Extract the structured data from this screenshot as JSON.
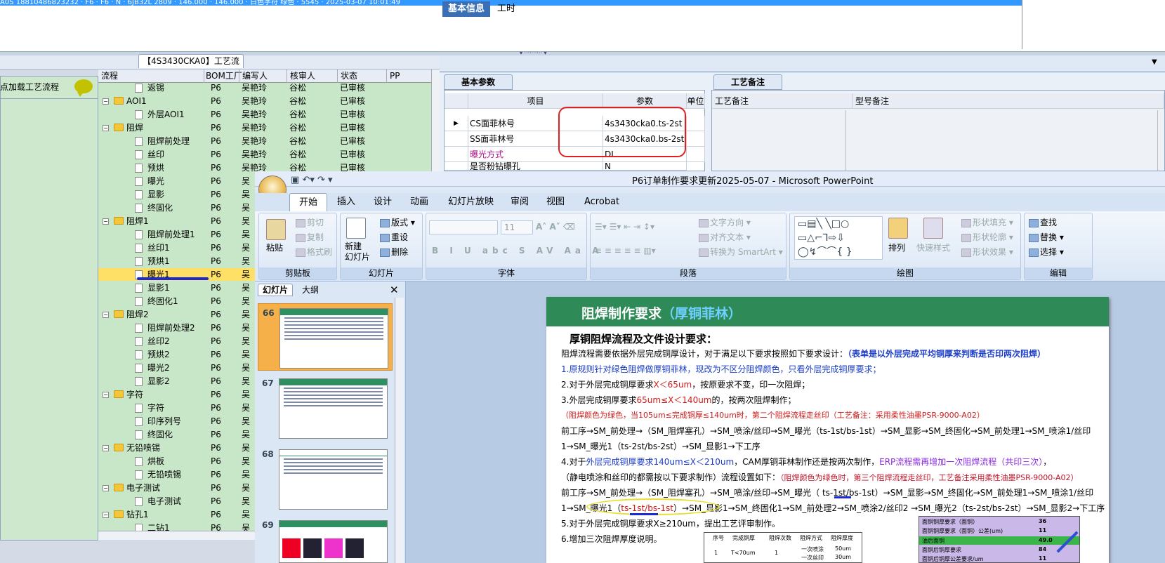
{
  "top_grid": {
    "selected_row_text": "A0S 18810486823232 · F6 · F6 · N · 6JB32L 2809 · 146.000 · 146.000 · 白色字符 绿色 · 5545 · 2025-03-07 10:01:49"
  },
  "process_panel": {
    "tab_title": "【4S3430CKA0】工艺流程",
    "load_label": "点加载工艺流程",
    "columns": [
      "流程",
      "BOM工厂",
      "编写人",
      "核审人",
      "状态",
      "PP"
    ],
    "rows": [
      {
        "level": 2,
        "type": "file",
        "name": "返锡",
        "factory": "P6",
        "writer": "吴艳玲",
        "reviewer": "谷松",
        "status": "已审核"
      },
      {
        "level": 1,
        "type": "folder",
        "name": "AOI1",
        "factory": "P6",
        "writer": "吴艳玲",
        "reviewer": "谷松",
        "status": "已审核"
      },
      {
        "level": 2,
        "type": "file",
        "name": "外层AOI1",
        "factory": "P6",
        "writer": "吴艳玲",
        "reviewer": "谷松",
        "status": "已审核"
      },
      {
        "level": 1,
        "type": "folder",
        "name": "阻焊",
        "factory": "P6",
        "writer": "吴艳玲",
        "reviewer": "谷松",
        "status": "已审核"
      },
      {
        "level": 2,
        "type": "file",
        "name": "阻焊前处理",
        "factory": "P6",
        "writer": "吴艳玲",
        "reviewer": "谷松",
        "status": "已审核"
      },
      {
        "level": 2,
        "type": "file",
        "name": "丝印",
        "factory": "P6",
        "writer": "吴艳玲",
        "reviewer": "谷松",
        "status": "已审核"
      },
      {
        "level": 2,
        "type": "file",
        "name": "预烘",
        "factory": "P6",
        "writer": "吴艳玲",
        "reviewer": "谷松",
        "status": "已审核"
      },
      {
        "level": 2,
        "type": "file",
        "name": "曝光",
        "factory": "P6",
        "writer": "吴",
        "reviewer": "",
        "status": ""
      },
      {
        "level": 2,
        "type": "file",
        "name": "显影",
        "factory": "P6",
        "writer": "吴",
        "reviewer": "",
        "status": ""
      },
      {
        "level": 2,
        "type": "file",
        "name": "终固化",
        "factory": "P6",
        "writer": "吴",
        "reviewer": "",
        "status": ""
      },
      {
        "level": 1,
        "type": "folder",
        "name": "阻焊1",
        "factory": "P6",
        "writer": "吴",
        "reviewer": "",
        "status": ""
      },
      {
        "level": 2,
        "type": "file",
        "name": "阻焊前处理1",
        "factory": "P6",
        "writer": "吴",
        "reviewer": "",
        "status": ""
      },
      {
        "level": 2,
        "type": "file",
        "name": "丝印1",
        "factory": "P6",
        "writer": "吴",
        "reviewer": "",
        "status": ""
      },
      {
        "level": 2,
        "type": "file",
        "name": "预烘1",
        "factory": "P6",
        "writer": "吴",
        "reviewer": "",
        "status": ""
      },
      {
        "level": 2,
        "type": "file",
        "name": "曝光1",
        "factory": "P6",
        "writer": "吴",
        "reviewer": "",
        "status": "",
        "selected": true
      },
      {
        "level": 2,
        "type": "file",
        "name": "显影1",
        "factory": "P6",
        "writer": "吴",
        "reviewer": "",
        "status": ""
      },
      {
        "level": 2,
        "type": "file",
        "name": "终固化1",
        "factory": "P6",
        "writer": "吴",
        "reviewer": "",
        "status": ""
      },
      {
        "level": 1,
        "type": "folder",
        "name": "阻焊2",
        "factory": "P6",
        "writer": "吴",
        "reviewer": "",
        "status": ""
      },
      {
        "level": 2,
        "type": "file",
        "name": "阻焊前处理2",
        "factory": "P6",
        "writer": "吴",
        "reviewer": "",
        "status": ""
      },
      {
        "level": 2,
        "type": "file",
        "name": "丝印2",
        "factory": "P6",
        "writer": "吴",
        "reviewer": "",
        "status": ""
      },
      {
        "level": 2,
        "type": "file",
        "name": "预烘2",
        "factory": "P6",
        "writer": "吴",
        "reviewer": "",
        "status": ""
      },
      {
        "level": 2,
        "type": "file",
        "name": "曝光2",
        "factory": "P6",
        "writer": "吴",
        "reviewer": "",
        "status": ""
      },
      {
        "level": 2,
        "type": "file",
        "name": "显影2",
        "factory": "P6",
        "writer": "吴",
        "reviewer": "",
        "status": ""
      },
      {
        "level": 1,
        "type": "folder",
        "name": "字符",
        "factory": "P6",
        "writer": "吴",
        "reviewer": "",
        "status": ""
      },
      {
        "level": 2,
        "type": "file",
        "name": "字符",
        "factory": "P6",
        "writer": "吴",
        "reviewer": "",
        "status": ""
      },
      {
        "level": 2,
        "type": "file",
        "name": "印序列号",
        "factory": "P6",
        "writer": "吴",
        "reviewer": "",
        "status": ""
      },
      {
        "level": 2,
        "type": "file",
        "name": "终固化",
        "factory": "P6",
        "writer": "吴",
        "reviewer": "",
        "status": ""
      },
      {
        "level": 1,
        "type": "folder",
        "name": "无铅喷锡",
        "factory": "P6",
        "writer": "吴",
        "reviewer": "",
        "status": ""
      },
      {
        "level": 2,
        "type": "file",
        "name": "烘板",
        "factory": "P6",
        "writer": "吴",
        "reviewer": "",
        "status": ""
      },
      {
        "level": 2,
        "type": "file",
        "name": "无铅喷锡",
        "factory": "P6",
        "writer": "吴",
        "reviewer": "",
        "status": ""
      },
      {
        "level": 1,
        "type": "folder",
        "name": "电子测试",
        "factory": "P6",
        "writer": "吴",
        "reviewer": "",
        "status": ""
      },
      {
        "level": 2,
        "type": "file",
        "name": "电子测试",
        "factory": "P6",
        "writer": "吴",
        "reviewer": "",
        "status": ""
      },
      {
        "level": 1,
        "type": "folder",
        "name": "钻孔1",
        "factory": "P6",
        "writer": "吴",
        "reviewer": "",
        "status": ""
      },
      {
        "level": 2,
        "type": "file",
        "name": "二钻1",
        "factory": "P6",
        "writer": "吴",
        "reviewer": "",
        "status": ""
      }
    ]
  },
  "info_panel": {
    "tabs": [
      "基本信息",
      "工时"
    ],
    "params_tab": "基本参数",
    "remarks_tab": "工艺备注",
    "param_columns": [
      "项目",
      "参数",
      "单位"
    ],
    "params": [
      {
        "item": "CS面菲林号",
        "value": "4s3430cka0.ts-2st",
        "unit": ""
      },
      {
        "item": "SS面菲林号",
        "value": "4s3430cka0.bs-2st",
        "unit": ""
      },
      {
        "item": "曝光方式",
        "value": "DI",
        "unit": ""
      },
      {
        "item": "是否粉钻曝孔",
        "value": "N",
        "unit": ""
      }
    ],
    "remark_columns": [
      "工艺备注",
      "型号备注"
    ]
  },
  "powerpoint": {
    "title": "P6订单制作要求更新2025-05-07 - Microsoft PowerPoint",
    "ribbon_tabs": [
      "开始",
      "插入",
      "设计",
      "动画",
      "幻灯片放映",
      "审阅",
      "视图",
      "Acrobat"
    ],
    "clipboard": {
      "label": "剪贴板",
      "paste": "粘贴",
      "cut": "剪切",
      "copy": "复制",
      "format_painter": "格式刷"
    },
    "slides_group": {
      "label": "幻灯片",
      "new_slide": "新建\n幻灯片",
      "layout": "版式",
      "reset": "重设",
      "delete": "删除"
    },
    "font_group": {
      "label": "字体",
      "size": "11"
    },
    "paragraph_group": {
      "label": "段落",
      "text_direction": "文字方向",
      "align_text": "对齐文本",
      "smartart": "转换为 SmartArt"
    },
    "drawing_group": {
      "label": "绘图",
      "arrange": "排列",
      "quick_styles": "快速样式",
      "shape_fill": "形状填充",
      "shape_outline": "形状轮廓",
      "shape_effects": "形状效果"
    },
    "editing_group": {
      "label": "编辑",
      "find": "查找",
      "replace": "替换",
      "select": "选择"
    },
    "pane_tabs": [
      "幻灯片",
      "大纲"
    ],
    "thumbs": [
      {
        "num": "66",
        "selected": true
      },
      {
        "num": "67",
        "selected": false
      },
      {
        "num": "68",
        "selected": false
      },
      {
        "num": "69",
        "selected": false
      }
    ]
  },
  "slide": {
    "title_a": "阻焊制作要求",
    "title_b": "（厚铜菲林）",
    "subtitle": "厚铜阻焊流程及文件设计要求：",
    "line1a": "阻焊流程需要依据外层完成铜厚设计，对于满足以下要求按照如下要求设计：",
    "line1b": "（表单是以外层完成平均铜厚来判断是否印两次阻焊）",
    "line2": "1.原规则针对绿色阻焊做厚铜菲林，现改为不区分阻焊颜色，只看外层完成铜厚要求；",
    "line3a": "2.对于外层完成铜厚要求",
    "line3b": "X＜65um",
    "line3c": "，按原要求不变，印一次阻焊；",
    "line4a": "3.外层完成铜厚要求",
    "line4b": "65um≤X＜140um",
    "line4c": "的，按两次阻焊制作；",
    "line5": "（阻焊颜色为绿色，当105um≤完成铜厚≤140um时，第二个阻焊流程走丝印（工艺备注：采用柔性油墨PSR-9000-A02）",
    "line6": "前工序→SM_前处理→（SM_阻焊塞孔）→SM_喷涂/丝印→SM_曝光（ts-1st/bs-1st）→SM_显影→SM_终固化→SM_前处理1→SM_喷涂1/丝印",
    "line7": "1→SM_曝光1（ts-2st/bs-2st）→SM_显影1→下工序",
    "line8a": "4.对于",
    "line8b": "外层完成铜厚要求",
    "line8c": "140um≤X＜210um",
    "line8d": "，CAM厚铜菲林制作还是按两次制作，",
    "line8e": "ERP流程需再增加一次阻焊流程（共印三次）",
    "line8f": "，",
    "line9a": "（静电喷涂和丝印的都需按以下要求制作）流程设置如下：",
    "line9b": "（阻焊颜色为绿色时，第三个阻焊流程走丝印，工艺备注采用柔性油墨PSR-9000-A02）",
    "line10": "前工序→SM_前处理→（SM_阻焊塞孔）→SM_喷涂/丝印→SM_曝光（ ts-1st/bs-1st）→SM_显影→SM_终固化→SM_前处理1→SM_喷涂1/丝印",
    "line11a": "1→SM_曝光1（",
    "line11b": "ts-1st/bs-1st",
    "line11c": "）→SM_显影1→SM_终固化1→SM_前处理2→SM_喷涂2/丝印2 →SM_曝光2（ts-2st/bs-2st）→SM_显影2→下工序",
    "line12": "5.对于外层完成铜厚要求X≥210um，提出工艺评审制作。",
    "line13": "6.增加三次阻焊厚度说明。",
    "mini_table_headers": [
      "序号",
      "完成铜厚",
      "阻焊次数",
      "阻焊方式",
      "阻焊厚度"
    ],
    "mini_table_row": [
      "1",
      "T<70um",
      "1",
      "一次喷涂",
      "50um"
    ],
    "mini_table_row2": [
      "",
      "",
      "",
      "一次丝印",
      "30um"
    ],
    "purple_table": [
      {
        "label": "面铜铜厚要求（面铜）",
        "value": "36"
      },
      {
        "label": "面铜铜厚要求（面铜）公差(um)",
        "value": "11"
      },
      {
        "label": "油后面铜",
        "value": "49.0"
      },
      {
        "label": "面铜后铜厚要求",
        "value": "84"
      },
      {
        "label": "面铜后铜厚公差要求/um",
        "value": "11"
      }
    ]
  }
}
